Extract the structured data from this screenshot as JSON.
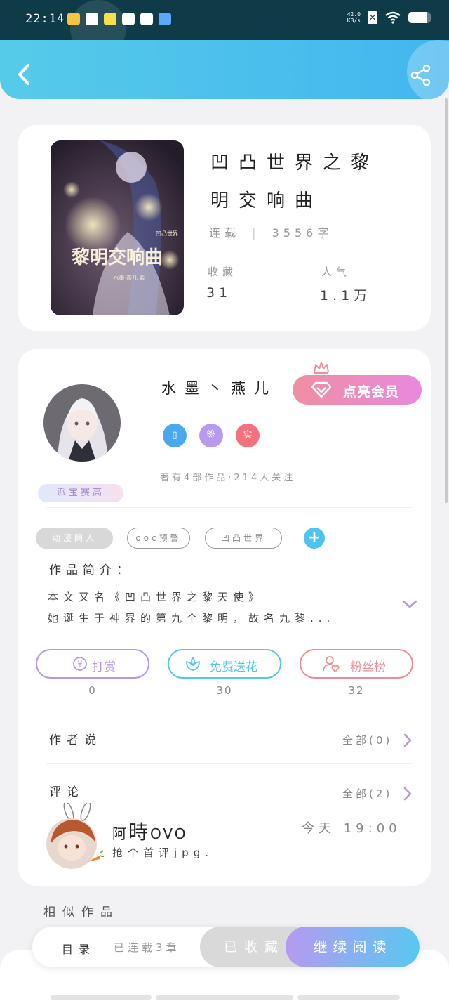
{
  "status_bar": {
    "time": "22:14",
    "net_speed_value": "42.0",
    "net_speed_unit": "KB/s",
    "battery_level": 0.82,
    "app_icons": [
      {
        "name": "cartoon-app-icon",
        "color": "#f5c542"
      },
      {
        "name": "wechat-icon",
        "color": "#ffffff"
      },
      {
        "name": "emoji-app-icon",
        "color": "#f3e04c"
      },
      {
        "name": "shield-icon",
        "color": "#ffffff"
      },
      {
        "name": "compass-icon",
        "color": "#ffffff"
      },
      {
        "name": "k-app-icon",
        "color": "#5aa9ff"
      }
    ]
  },
  "book": {
    "title_line1": "凹凸世界之黎",
    "title_line2": "明交响曲",
    "status": "连载",
    "word_count": "3556字",
    "cover_title": "黎明交响曲",
    "cover_subtitle": "凹凸世界",
    "cover_author": "水墨·燕儿 著",
    "stats": {
      "favorites_label": "收藏",
      "favorites_value": "31",
      "popularity_label": "人气",
      "popularity_value": "1.1万"
    }
  },
  "author": {
    "name": "水墨丶燕儿",
    "vip_button": "点亮会员",
    "badge_label": "派宝赛高",
    "tags": [
      {
        "label": "▯",
        "color": "#4aa8ee"
      },
      {
        "label": "签",
        "color": "#b79af0"
      },
      {
        "label": "实",
        "color": "#f3727e"
      }
    ],
    "works_info": "著有4部作品·214人关注"
  },
  "genre_tags": [
    "动漫同人",
    "ooc预警",
    "凹凸世界"
  ],
  "intro": {
    "title": "作品简介：",
    "line1": "本文又名《凹凸世界之黎天使》",
    "line2": "她诞生于神界的第九个黎明，故名九黎..."
  },
  "actions": [
    {
      "label": "打赏",
      "count": "0",
      "color": "#b598e2",
      "icon": "yen-coin-icon"
    },
    {
      "label": "免费送花",
      "count": "30",
      "color": "#54c7e6",
      "icon": "flower-icon"
    },
    {
      "label": "粉丝榜",
      "count": "32",
      "color": "#ee8c93",
      "icon": "fan-user-icon"
    }
  ],
  "author_says": {
    "title": "作者说",
    "all": "全部(0)"
  },
  "comments": {
    "title": "评论",
    "all": "全部(2)",
    "first": {
      "name_prefix": "阿",
      "name_big": "時",
      "name_suffix": "OVO",
      "time": "今天 19:00",
      "text": "抢个首评jpg."
    }
  },
  "similar": {
    "title": "相似作品"
  },
  "bottom_bar": {
    "toc": "目录",
    "chapters": "已连载3章",
    "collected": "已收藏",
    "continue": "继续阅读"
  }
}
